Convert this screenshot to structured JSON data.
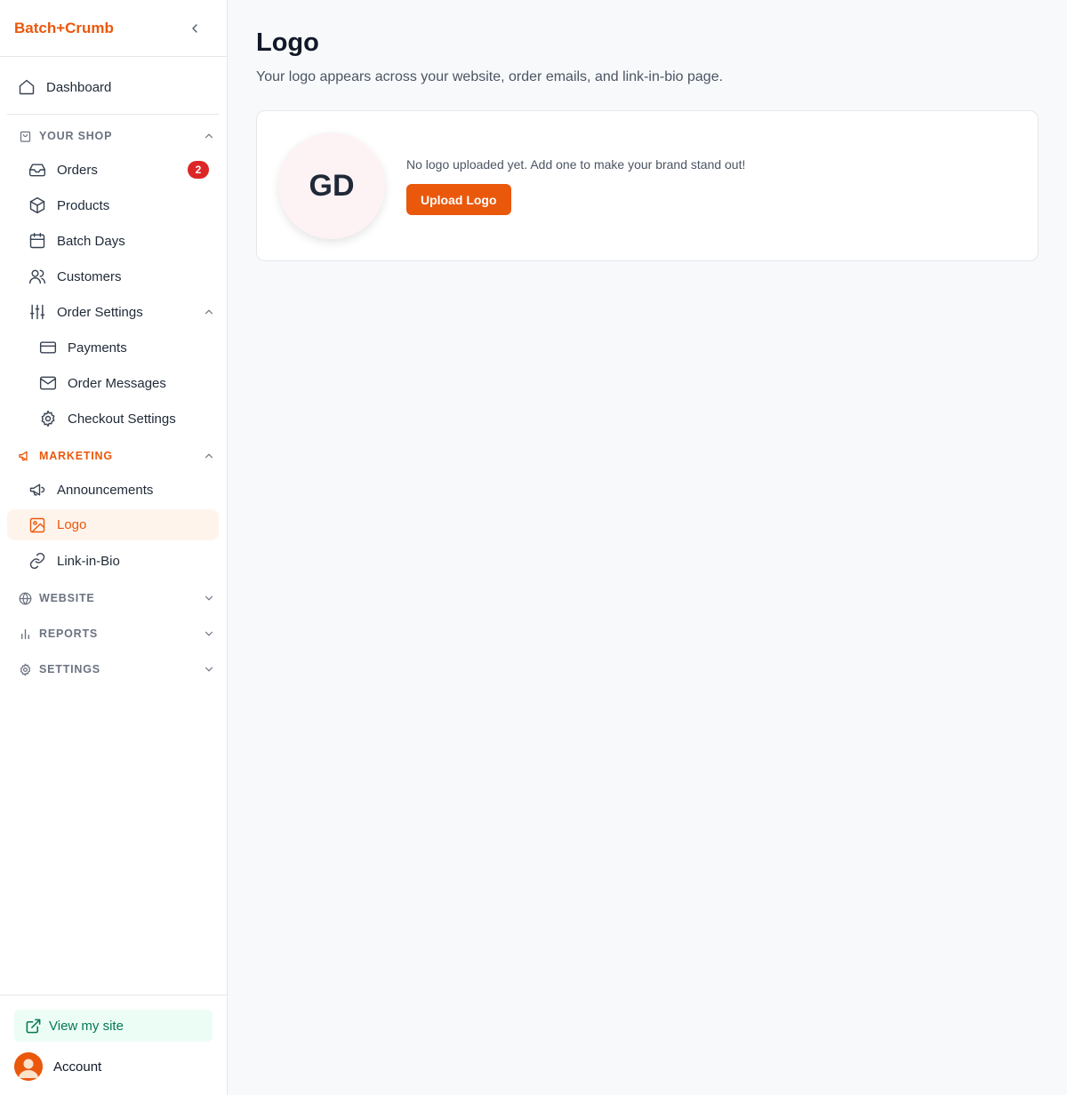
{
  "app": {
    "brand": "Batch+Crumb"
  },
  "sidebar": {
    "dashboard": "Dashboard",
    "your_shop": {
      "label": "YOUR SHOP",
      "items": [
        {
          "label": "Orders",
          "icon": "inbox-icon",
          "badge": "2"
        },
        {
          "label": "Products",
          "icon": "box-icon"
        },
        {
          "label": "Batch Days",
          "icon": "calendar-icon"
        },
        {
          "label": "Customers",
          "icon": "users-icon"
        },
        {
          "label": "Order Settings",
          "icon": "sliders-icon"
        }
      ],
      "order_settings_sub": [
        {
          "label": "Payments",
          "icon": "credit-card-icon"
        },
        {
          "label": "Order Messages",
          "icon": "mail-icon"
        },
        {
          "label": "Checkout Settings",
          "icon": "gear-icon"
        }
      ]
    },
    "marketing": {
      "label": "MARKETING",
      "items": [
        {
          "label": "Announcements",
          "icon": "megaphone-icon"
        },
        {
          "label": "Logo",
          "icon": "image-icon",
          "active": true
        },
        {
          "label": "Link-in-Bio",
          "icon": "link-icon"
        }
      ]
    },
    "website": "WEBSITE",
    "reports": "REPORTS",
    "settings": "SETTINGS",
    "footer": {
      "view_site": "View my site",
      "account": "Account"
    }
  },
  "main": {
    "title": "Logo",
    "subtitle": "Your logo appears across your website, order emails, and link-in-bio page.",
    "card": {
      "initials": "GD",
      "message": "No logo uploaded yet. Add one to make your brand stand out!",
      "button": "Upload Logo"
    }
  },
  "colors": {
    "accent": "#ea580c",
    "badge": "#dc2626",
    "active_bg": "#fff4ec",
    "site_btn_bg": "#ecfdf5",
    "site_btn_fg": "#047857"
  }
}
